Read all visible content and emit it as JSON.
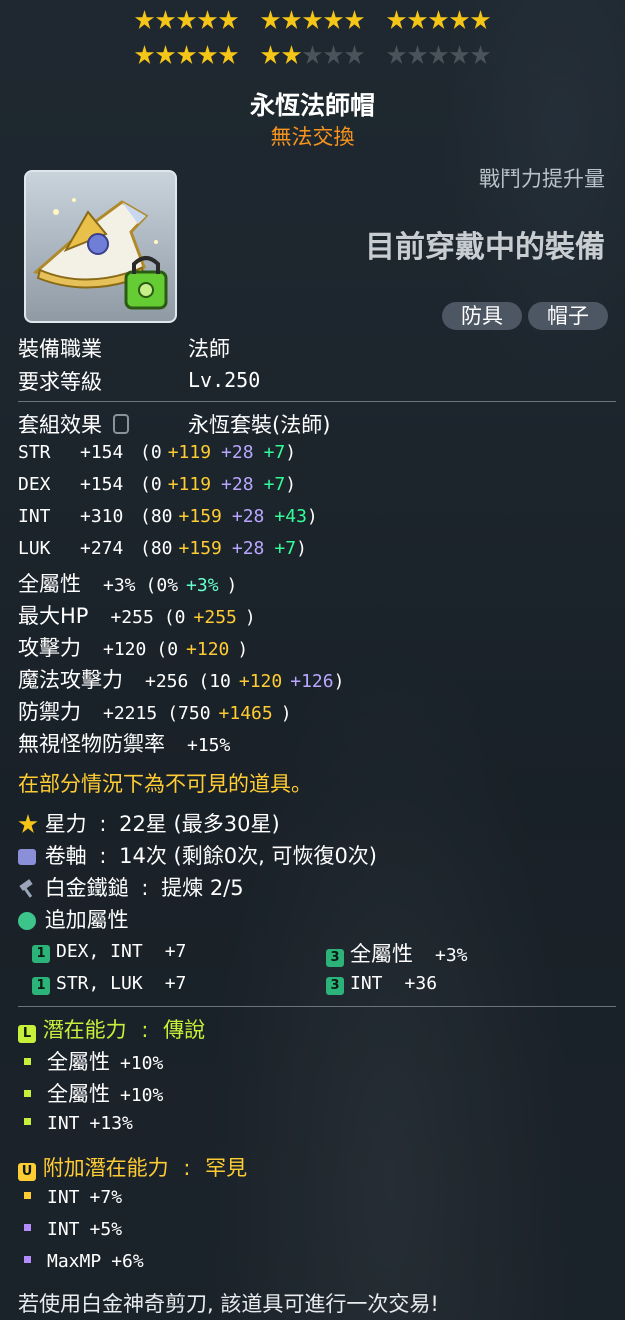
{
  "star_force": {
    "filled": 22,
    "total": 30,
    "colors": {
      "filled": "#f5c518",
      "empty": "#4a525a"
    }
  },
  "item": {
    "name": "永恆法師帽",
    "trade_status": "無法交換",
    "icon": "wizard-hat-icon",
    "power_label": "戰鬥力提升量",
    "equipped_label": "目前穿戴中的裝備",
    "tags": [
      "防具",
      "帽子"
    ]
  },
  "requirements": [
    {
      "label": "裝備職業",
      "value": "法師"
    },
    {
      "label": "要求等級",
      "value": "Lv.250"
    }
  ],
  "set_effect": {
    "label": "套組效果",
    "icon": "lock-icon",
    "value": "永恆套裝(法師)"
  },
  "stats": [
    {
      "name": "STR",
      "total": "+154",
      "base": "(0",
      "bonus1": "+119",
      "bonus2": "+28",
      "bonus3": "+7",
      "close": ")"
    },
    {
      "name": "DEX",
      "total": "+154",
      "base": "(0",
      "bonus1": "+119",
      "bonus2": "+28",
      "bonus3": "+7",
      "close": ")"
    },
    {
      "name": "INT",
      "total": "+310",
      "base": "(80",
      "bonus1": "+159",
      "bonus2": "+28",
      "bonus3": "+43",
      "close": ")"
    },
    {
      "name": "LUK",
      "total": "+274",
      "base": "(80",
      "bonus1": "+159",
      "bonus2": "+28",
      "bonus3": "+7",
      "close": ")"
    }
  ],
  "other_stats": [
    {
      "name": "全屬性",
      "total": "+3%",
      "base": "(0%",
      "extra": "+3%",
      "extra_color": "#66ffcc",
      "close": ")"
    },
    {
      "name": "最大HP",
      "total": "+255",
      "base": "(0",
      "extra": "+255",
      "extra_color": "#ffcc33",
      "close": ")"
    },
    {
      "name": "攻擊力",
      "total": "+120",
      "base": "(0",
      "extra": "+120",
      "extra_color": "#ffcc33",
      "close": ")"
    },
    {
      "name": "魔法攻擊力",
      "total": "+256",
      "base": "(10",
      "extra": "+120",
      "extra_color": "#ffcc33",
      "extra2": "+126",
      "extra2_color": "#b9a7ff",
      "close": ")"
    },
    {
      "name": "防禦力",
      "total": "+2215",
      "base": "(750",
      "extra": "+1465",
      "extra_color": "#ffcc33",
      "close": ")"
    },
    {
      "name": "無視怪物防禦率",
      "total": "+15%",
      "base": "",
      "extra": "",
      "close": ""
    }
  ],
  "invisible_note": "在部分情況下為不可見的道具。",
  "enhancements": [
    {
      "icon": "star-icon",
      "label": "星力",
      "sep": ":",
      "value": "22星 (最多30星)"
    },
    {
      "icon": "scroll-icon",
      "label": "卷軸",
      "sep": ":",
      "value": "14次 (剩餘0次, 可恢復0次)"
    },
    {
      "icon": "hammer-icon",
      "label": "白金鐵鎚",
      "sep": ":",
      "value": "提煉 2/5"
    },
    {
      "icon": "leaf-icon",
      "label": "追加屬性",
      "sep": "",
      "value": ""
    }
  ],
  "bonus_stats": [
    {
      "tier": "1",
      "text": "DEX, INT",
      "value": "+7"
    },
    {
      "tier": "3",
      "text": "全屬性",
      "value": "+3%"
    },
    {
      "tier": "1",
      "text": "STR, LUK",
      "value": "+7"
    },
    {
      "tier": "3",
      "text": "INT",
      "value": "+36"
    }
  ],
  "potential": {
    "badge": "L",
    "label": "潛在能力",
    "sep": ":",
    "grade": "傳說",
    "color": "#c6f03a",
    "lines": [
      {
        "text": "全屬性",
        "value": "+10%"
      },
      {
        "text": "全屬性",
        "value": "+10%"
      },
      {
        "text": "INT",
        "value": "+13%"
      }
    ]
  },
  "additional_potential": {
    "badge": "U",
    "label": "附加潛在能力",
    "sep": ":",
    "grade": "罕見",
    "color": "#ffcc33",
    "lines": [
      {
        "text": "INT",
        "value": "+7%",
        "bullet_color": "#ffcc33"
      },
      {
        "text": "INT",
        "value": "+5%",
        "bullet_color": "#b38cff"
      },
      {
        "text": "MaxMP",
        "value": "+6%",
        "bullet_color": "#b38cff"
      }
    ]
  },
  "footer_note": "若使用白金神奇剪刀, 該道具可進行一次交易!"
}
